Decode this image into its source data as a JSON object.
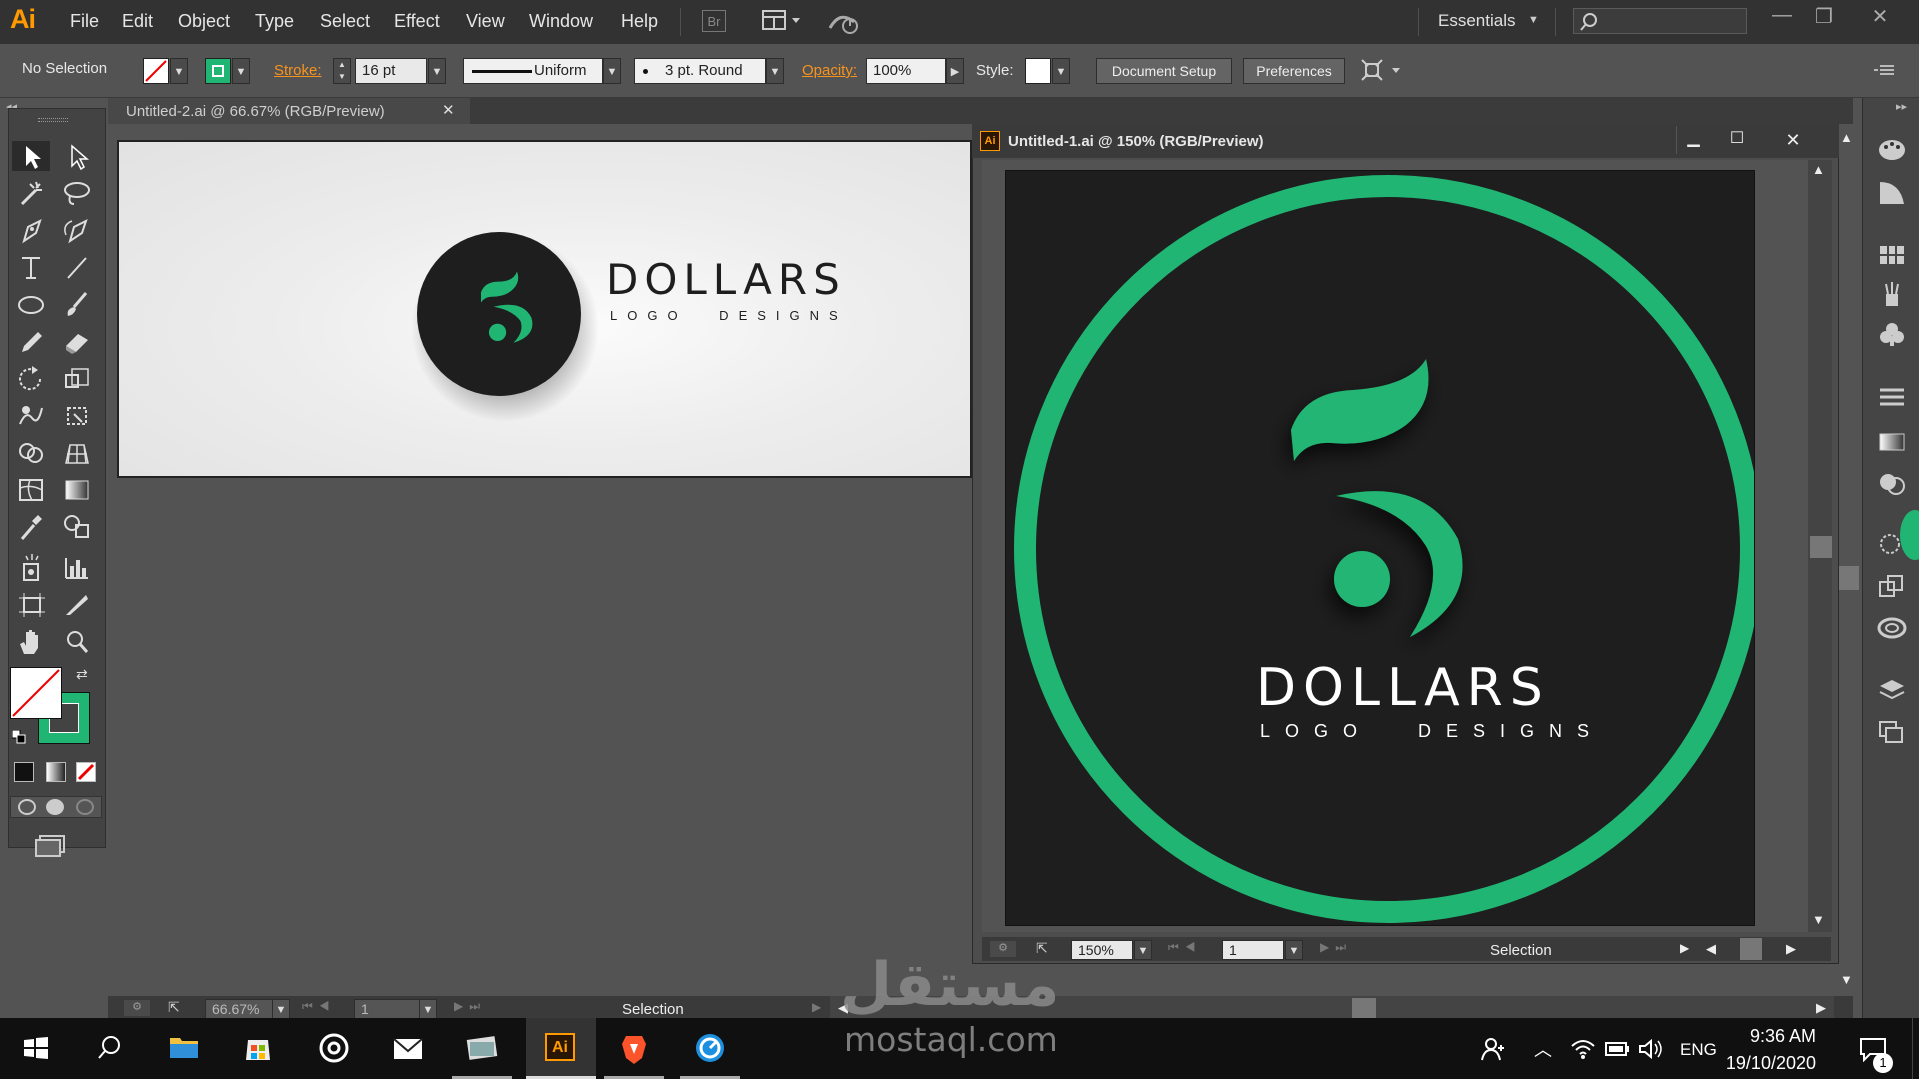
{
  "app": {
    "logo": "Ai",
    "menu": [
      "File",
      "Edit",
      "Object",
      "Type",
      "Select",
      "Effect",
      "View",
      "Window",
      "Help"
    ],
    "bridge_label": "Br",
    "workspace": "Essentials"
  },
  "control_bar": {
    "selection_status": "No Selection",
    "stroke_label": "Stroke:",
    "stroke_weight": "16 pt",
    "stroke_profile": "Uniform",
    "brush": "3 pt. Round",
    "opacity_label": "Opacity:",
    "opacity_value": "100%",
    "style_label": "Style:",
    "document_setup": "Document Setup",
    "preferences": "Preferences"
  },
  "doc2": {
    "tab_title": "Untitled-2.ai @ 66.67% (RGB/Preview)",
    "zoom": "66.67%",
    "page": "1",
    "status": "Selection"
  },
  "doc1": {
    "title": "Untitled-1.ai @ 150% (RGB/Preview)",
    "zoom": "150%",
    "page": "1",
    "status": "Selection"
  },
  "artwork": {
    "brand": "DOLLARS",
    "tagline": "LOGO DESIGNS",
    "numeral": "5",
    "brand_green": "#21b573",
    "dark": "#1e1e1e"
  },
  "taskbar": {
    "time": "9:36 AM",
    "date": "19/10/2020",
    "language": "ENG",
    "notification_count": "1",
    "illustrator_label": "Ai"
  },
  "watermark": {
    "arabic": "مستقل",
    "latin": "mostaql.com"
  }
}
